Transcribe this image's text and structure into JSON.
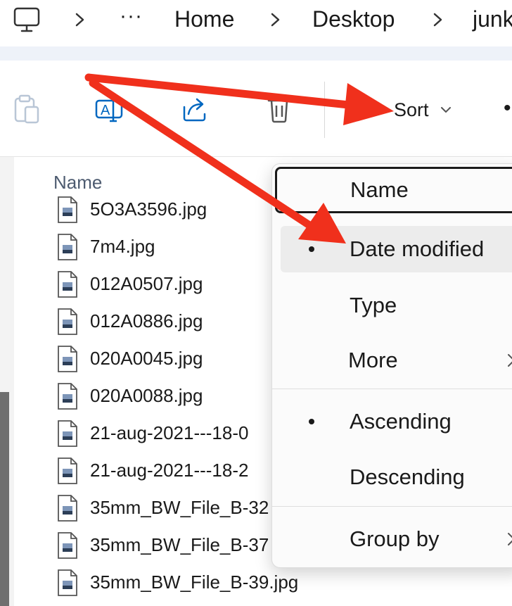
{
  "addressbar": {
    "computer_icon": "monitor-icon",
    "more_label": "···",
    "crumbs": [
      "Home",
      "Desktop",
      "junk"
    ]
  },
  "commandbar": {
    "icons": [
      "clipboard-icon",
      "rename-icon",
      "share-icon",
      "delete-icon"
    ],
    "sort_label": "Sort",
    "more_dots": "•"
  },
  "filelist": {
    "column_name": "Name",
    "files": [
      "5O3A3596.jpg",
      "7m4.jpg",
      "012A0507.jpg",
      "012A0886.jpg",
      "020A0045.jpg",
      "020A0088.jpg",
      "21-aug-2021---18-0",
      "21-aug-2021---18-2",
      "35mm_BW_File_B-32",
      "35mm_BW_File_B-37",
      "35mm_BW_File_B-39.jpg"
    ]
  },
  "sort_menu": {
    "items": {
      "name": "Name",
      "date_modified": "Date modified",
      "type": "Type",
      "more": "More",
      "ascending": "Ascending",
      "descending": "Descending",
      "group_by": "Group by"
    },
    "selected_field": "Date modified",
    "selected_order": "Ascending"
  },
  "colors": {
    "annotation_arrow": "#f0301c",
    "accent": "#0067c0"
  }
}
